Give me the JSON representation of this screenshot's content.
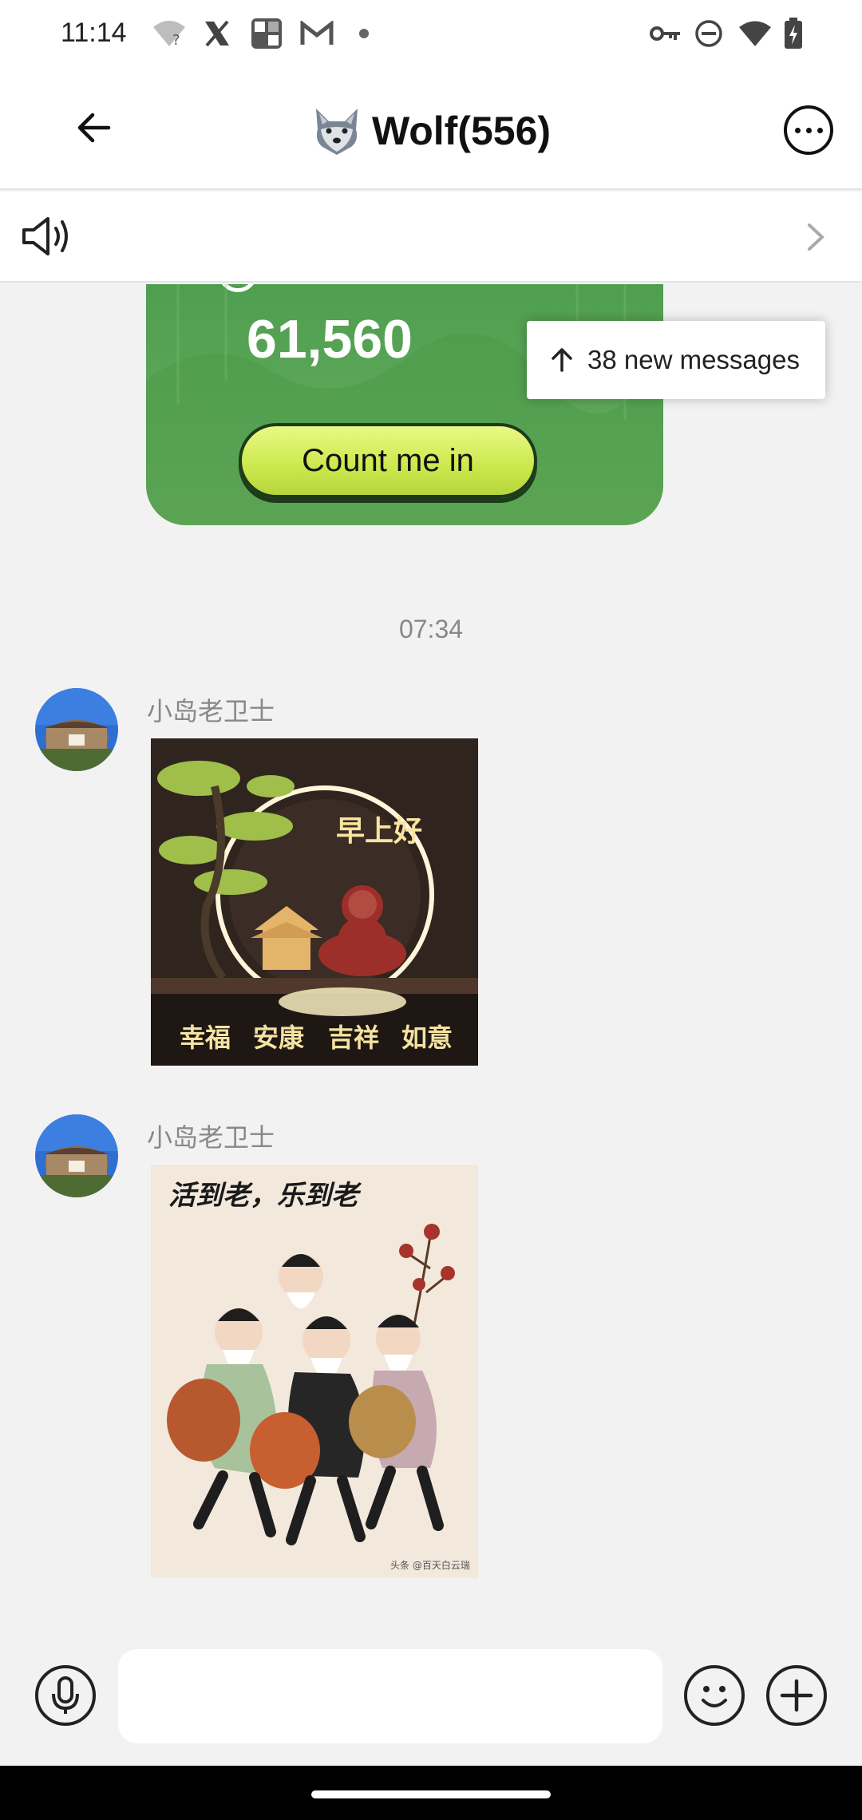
{
  "status_bar": {
    "time": "11:14",
    "left_icons": [
      "wifi-question-icon",
      "x-logo-icon",
      "puzzle-app-icon",
      "gmail-icon",
      "dot-icon"
    ],
    "right_icons": [
      "vpn-key-icon",
      "do-not-disturb-icon",
      "wifi-icon",
      "battery-charging-icon"
    ]
  },
  "header": {
    "title": "Wolf(556)",
    "title_emoji": "wolf-icon"
  },
  "chat": {
    "promo": {
      "amount": "61,560",
      "button_label": "Count me in"
    },
    "new_messages_label": "38 new messages",
    "timestamp": "07:34",
    "messages": [
      {
        "sender": "小岛老卫士",
        "image": {
          "greeting": "早上好",
          "caption_words": [
            "幸福",
            "安康",
            "吉祥",
            "如意"
          ]
        }
      },
      {
        "sender": "小岛老卫士",
        "image": {
          "title": "活到老，乐到老",
          "watermark": "头条 @百天白云瑞"
        }
      }
    ]
  },
  "input_bar": {
    "placeholder": ""
  },
  "colors": {
    "promo_green": "#5fa85a",
    "button_lime": "#cbe84b",
    "background": "#f2f2f2"
  }
}
